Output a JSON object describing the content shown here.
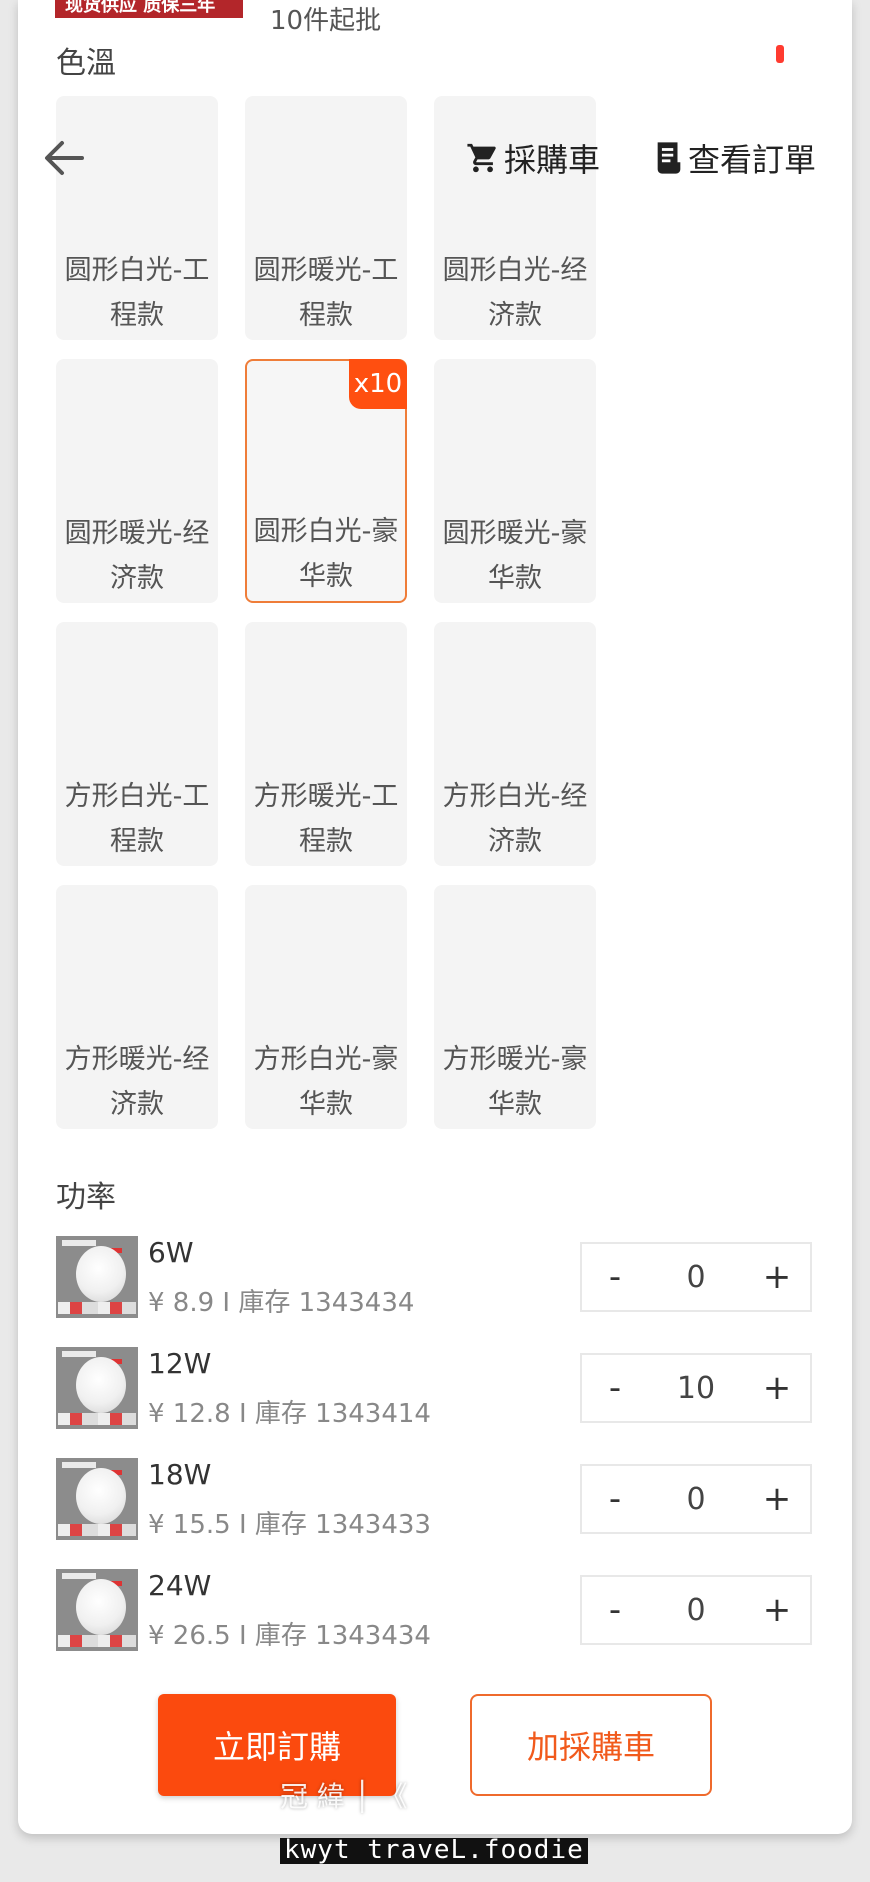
{
  "header": {
    "promo_badge": "现货供应 质保三年",
    "min_order": "10件起批",
    "cart_link": "採購車",
    "orders_link": "查看訂單"
  },
  "color_temp": {
    "label": "色溫",
    "options": [
      {
        "line1": "圆形白光-工",
        "line2": "程款"
      },
      {
        "line1": "圆形暖光-工",
        "line2": "程款"
      },
      {
        "line1": "圆形白光-经",
        "line2": "济款"
      },
      {
        "line1": "圆形暖光-经",
        "line2": "济款"
      },
      {
        "line1": "圆形白光-豪",
        "line2": "华款",
        "badge": "x10",
        "selected": true
      },
      {
        "line1": "圆形暖光-豪",
        "line2": "华款"
      },
      {
        "line1": "方形白光-工",
        "line2": "程款"
      },
      {
        "line1": "方形暖光-工",
        "line2": "程款"
      },
      {
        "line1": "方形白光-经",
        "line2": "济款"
      },
      {
        "line1": "方形暖光-经",
        "line2": "济款"
      },
      {
        "line1": "方形白光-豪",
        "line2": "华款"
      },
      {
        "line1": "方形暖光-豪",
        "line2": "华款"
      }
    ]
  },
  "power": {
    "label": "功率",
    "items": [
      {
        "watt": "6W",
        "meta": "¥ 8.9 I 庫存 1343434",
        "qty": "0"
      },
      {
        "watt": "12W",
        "meta": "¥ 12.8 I 庫存 1343414",
        "qty": "10"
      },
      {
        "watt": "18W",
        "meta": "¥ 15.5 I 庫存 1343433",
        "qty": "0"
      },
      {
        "watt": "24W",
        "meta": "¥ 26.5 I 庫存 1343434",
        "qty": "0"
      }
    ],
    "minus": "-",
    "plus": "+"
  },
  "actions": {
    "order_now": "立即訂購",
    "add_to_cart": "加採購車"
  },
  "watermark": {
    "line1": "冠 緯 │ 《",
    "line2": "kwyt traveL.foodie"
  },
  "colors": {
    "accent": "#fb4a0e",
    "badge": "#ff4f10",
    "promo": "#b3262a"
  }
}
